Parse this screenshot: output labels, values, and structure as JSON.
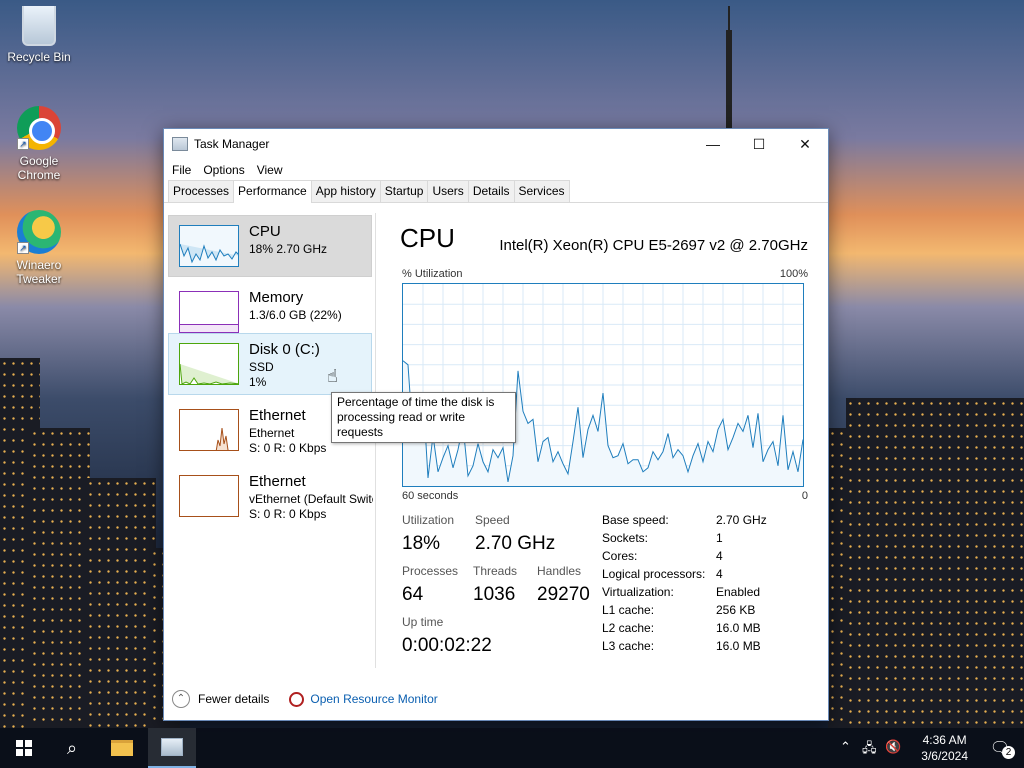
{
  "desktop": {
    "icons": [
      {
        "label": "Recycle Bin"
      },
      {
        "label": "Google Chrome"
      },
      {
        "label": "Winaero Tweaker"
      }
    ]
  },
  "window": {
    "title": "Task Manager",
    "menu": [
      "File",
      "Options",
      "View"
    ],
    "tabs": [
      "Processes",
      "Performance",
      "App history",
      "Startup",
      "Users",
      "Details",
      "Services"
    ],
    "active_tab": "Performance"
  },
  "resources": [
    {
      "name": "CPU",
      "line2": "18% 2.70 GHz",
      "line3": "",
      "color": "#1f7ebd"
    },
    {
      "name": "Memory",
      "line2": "1.3/6.0 GB (22%)",
      "line3": "",
      "color": "#8b2fb8"
    },
    {
      "name": "Disk 0 (C:)",
      "line2": "SSD",
      "line3": "1%",
      "color": "#4da60c"
    },
    {
      "name": "Ethernet",
      "line2": "Ethernet",
      "line3_s": "S: 0 R: 0 Kbps",
      "color": "#a7501a"
    },
    {
      "name": "Ethernet",
      "line2": "vEthernet (Default Switc",
      "line3_s": "S: 0 R: 0 Kbps",
      "color": "#a7501a"
    }
  ],
  "detail": {
    "title": "CPU",
    "cpu_name": "Intel(R) Xeon(R) CPU E5-2697 v2 @ 2.70GHz",
    "graph_label": "% Utilization",
    "graph_max": "100%",
    "graph_time": "60 seconds",
    "graph_min": "0",
    "stats": {
      "utilization_label": "Utilization",
      "utilization": "18%",
      "speed_label": "Speed",
      "speed": "2.70 GHz",
      "processes_label": "Processes",
      "processes": "64",
      "threads_label": "Threads",
      "threads": "1036",
      "handles_label": "Handles",
      "handles": "29270",
      "uptime_label": "Up time",
      "uptime": "0:00:02:22"
    },
    "specs": [
      {
        "k": "Base speed:",
        "v": "2.70 GHz"
      },
      {
        "k": "Sockets:",
        "v": "1"
      },
      {
        "k": "Cores:",
        "v": "4"
      },
      {
        "k": "Logical processors:",
        "v": "4"
      },
      {
        "k": "Virtualization:",
        "v": "Enabled"
      },
      {
        "k": "L1 cache:",
        "v": "256 KB"
      },
      {
        "k": "L2 cache:",
        "v": "16.0 MB"
      },
      {
        "k": "L3 cache:",
        "v": "16.0 MB"
      }
    ],
    "cpu_history": [
      62,
      60,
      24,
      40,
      46,
      4,
      25,
      7,
      14,
      20,
      9,
      18,
      30,
      5,
      10,
      21,
      12,
      7,
      18,
      14,
      19,
      2,
      15,
      57,
      37,
      31,
      33,
      12,
      22,
      24,
      12,
      17,
      11,
      6,
      22,
      39,
      14,
      28,
      35,
      27,
      46,
      20,
      14,
      15,
      21,
      11,
      13,
      13,
      7,
      9,
      17,
      13,
      17,
      26,
      14,
      18,
      15,
      7,
      15,
      21,
      12,
      22,
      17,
      28,
      33,
      18,
      24,
      31,
      27,
      35,
      19,
      36,
      12,
      18,
      22,
      10,
      35,
      8,
      17,
      7,
      23
    ]
  },
  "footer": {
    "fewer_details": "Fewer details",
    "open_resource_monitor": "Open Resource Monitor"
  },
  "tooltip": {
    "line1": "Percentage of time the disk is",
    "line2": "processing read or write requests"
  },
  "taskbar": {
    "time": "4:36 AM",
    "date": "3/6/2024",
    "notification_count": "2"
  }
}
